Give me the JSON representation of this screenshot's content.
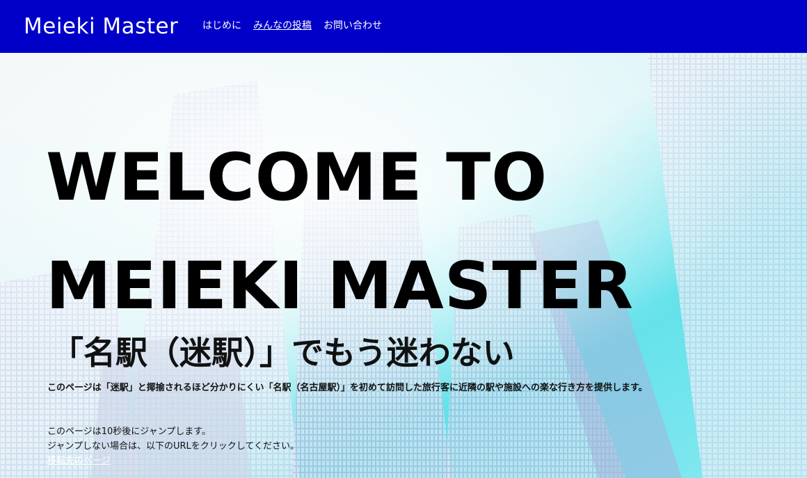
{
  "header": {
    "brand": "Meieki Master",
    "nav": [
      {
        "label": "はじめに"
      },
      {
        "label": "みんなの投稿"
      },
      {
        "label": "お問い合わせ"
      }
    ]
  },
  "hero": {
    "title_line1": "WELCOME TO",
    "title_line2": "MEIEKI MASTER",
    "tagline": "「名駅（迷駅）」でもう迷わない",
    "description": "このページは「迷駅」と揶揄されるほど分かりにくい「名駅（名古屋駅）」を初めて訪問した旅行客に近隣の駅や施設への楽な行き方を提供します。"
  },
  "redirect": {
    "line1": "このページは10秒後にジャンプします。",
    "line2": "ジャンプしない場合は、以下のURLをクリックしてください。",
    "link_label": "移転先のページ"
  },
  "colors": {
    "header_bg": "#0000c8",
    "header_text": "#ffffff",
    "sky": "#38d8e4"
  }
}
